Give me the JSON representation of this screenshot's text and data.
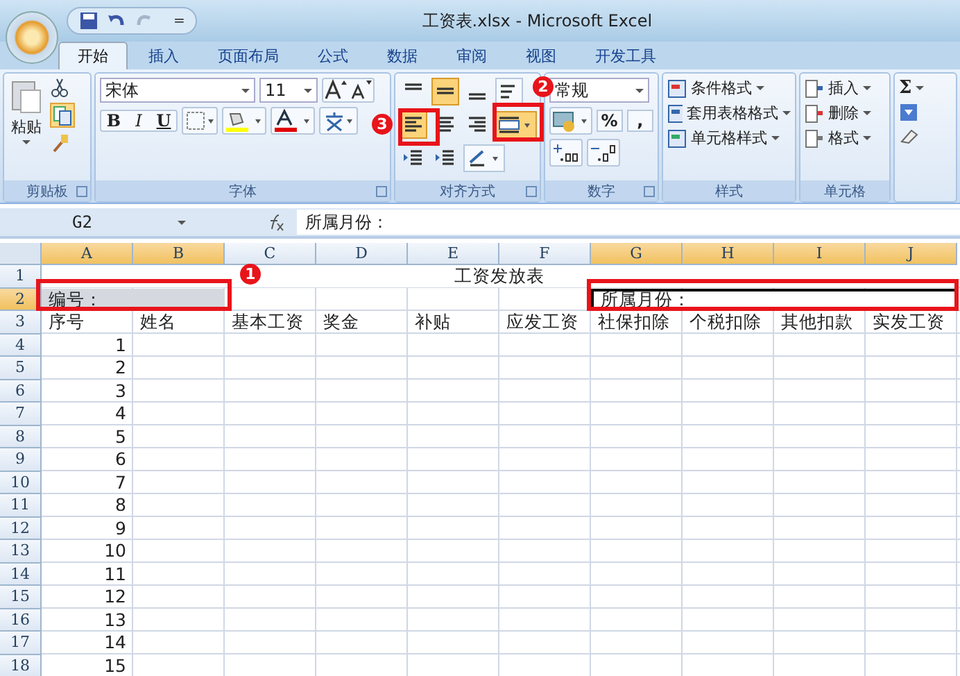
{
  "window": {
    "title": "工资表.xlsx - Microsoft Excel",
    "quick_access_more": "="
  },
  "tabs": [
    {
      "label": "开始",
      "selected": true
    },
    {
      "label": "插入",
      "selected": false
    },
    {
      "label": "页面布局",
      "selected": false
    },
    {
      "label": "公式",
      "selected": false
    },
    {
      "label": "数据",
      "selected": false
    },
    {
      "label": "审阅",
      "selected": false
    },
    {
      "label": "视图",
      "selected": false
    },
    {
      "label": "开发工具",
      "selected": false
    }
  ],
  "ribbon": {
    "clipboard": {
      "label": "剪贴板",
      "paste": "粘贴"
    },
    "font": {
      "label": "字体",
      "font_name": "宋体",
      "font_size": "11",
      "bold": "B",
      "italic": "I",
      "underline": "U"
    },
    "alignment": {
      "label": "对齐方式",
      "buttons": [
        {
          "kind": "top",
          "selected": false
        },
        {
          "kind": "middle",
          "selected": true
        },
        {
          "kind": "bottom",
          "selected": false
        },
        {
          "kind": "wrap",
          "selected": false
        },
        {
          "kind": "left",
          "selected": true
        },
        {
          "kind": "center",
          "selected": false
        },
        {
          "kind": "right",
          "selected": false
        },
        {
          "kind": "merge",
          "selected": true
        },
        {
          "kind": "outdent",
          "selected": false
        },
        {
          "kind": "indent",
          "selected": false
        },
        {
          "kind": "orientation",
          "selected": false
        }
      ]
    },
    "number": {
      "label": "数字",
      "format": "常规",
      "percent": "%",
      "comma": ","
    },
    "styles": {
      "label": "样式",
      "items": [
        "条件格式",
        "套用表格格式",
        "单元格样式"
      ]
    },
    "cells": {
      "label": "单元格",
      "items": [
        "插入",
        "删除",
        "格式"
      ]
    },
    "editing": {
      "sum": "Σ"
    }
  },
  "formula_bar": {
    "name_box": "G2",
    "content": "所属月份："
  },
  "sheet": {
    "columns": [
      {
        "label": "A",
        "selected": true
      },
      {
        "label": "B",
        "selected": true
      },
      {
        "label": "C",
        "selected": false
      },
      {
        "label": "D",
        "selected": false
      },
      {
        "label": "E",
        "selected": false
      },
      {
        "label": "F",
        "selected": false
      },
      {
        "label": "G",
        "selected": true
      },
      {
        "label": "H",
        "selected": true
      },
      {
        "label": "I",
        "selected": true
      },
      {
        "label": "J",
        "selected": true
      }
    ],
    "rows": [
      {
        "header": "1",
        "selected": false,
        "cells": [
          {
            "kind": "title",
            "text": "工资发放表"
          }
        ]
      },
      {
        "header": "2",
        "selected": true,
        "cells": [
          {
            "kind": "label",
            "text": "编号：",
            "selected": true
          },
          {
            "kind": "merged"
          },
          {
            "kind": "empty"
          },
          {
            "kind": "empty"
          },
          {
            "kind": "empty"
          },
          {
            "kind": "empty"
          },
          {
            "kind": "active",
            "text": "所属月份："
          }
        ]
      },
      {
        "header": "3",
        "selected": false,
        "cells": [
          {
            "kind": "text",
            "text": "序号"
          },
          {
            "kind": "text",
            "text": "姓名"
          },
          {
            "kind": "text",
            "text": "基本工资"
          },
          {
            "kind": "text",
            "text": "奖金"
          },
          {
            "kind": "text",
            "text": "补贴"
          },
          {
            "kind": "text",
            "text": "应发工资"
          },
          {
            "kind": "text",
            "text": "社保扣除"
          },
          {
            "kind": "text",
            "text": "个税扣除"
          },
          {
            "kind": "text",
            "text": "其他扣款"
          },
          {
            "kind": "text",
            "text": "实发工资"
          }
        ]
      },
      {
        "header": "4",
        "selected": false,
        "cells": [
          {
            "kind": "number",
            "text": "1"
          }
        ]
      },
      {
        "header": "5",
        "selected": false,
        "cells": [
          {
            "kind": "number",
            "text": "2"
          }
        ]
      },
      {
        "header": "6",
        "selected": false,
        "cells": [
          {
            "kind": "number",
            "text": "3"
          }
        ]
      },
      {
        "header": "7",
        "selected": false,
        "cells": [
          {
            "kind": "number",
            "text": "4"
          }
        ]
      },
      {
        "header": "8",
        "selected": false,
        "cells": [
          {
            "kind": "number",
            "text": "5"
          }
        ]
      },
      {
        "header": "9",
        "selected": false,
        "cells": [
          {
            "kind": "number",
            "text": "6"
          }
        ]
      },
      {
        "header": "10",
        "selected": false,
        "cells": [
          {
            "kind": "number",
            "text": "7"
          }
        ]
      },
      {
        "header": "11",
        "selected": false,
        "cells": [
          {
            "kind": "number",
            "text": "8"
          }
        ]
      },
      {
        "header": "12",
        "selected": false,
        "cells": [
          {
            "kind": "number",
            "text": "9"
          }
        ]
      },
      {
        "header": "13",
        "selected": false,
        "cells": [
          {
            "kind": "number",
            "text": "10"
          }
        ]
      },
      {
        "header": "14",
        "selected": false,
        "cells": [
          {
            "kind": "number",
            "text": "11"
          }
        ]
      },
      {
        "header": "15",
        "selected": false,
        "cells": [
          {
            "kind": "number",
            "text": "12"
          }
        ]
      },
      {
        "header": "16",
        "selected": false,
        "cells": [
          {
            "kind": "number",
            "text": "13"
          }
        ]
      },
      {
        "header": "17",
        "selected": false,
        "cells": [
          {
            "kind": "number",
            "text": "14"
          }
        ]
      },
      {
        "header": "18",
        "selected": false,
        "cells": [
          {
            "kind": "number",
            "text": "15"
          }
        ]
      }
    ]
  },
  "step_badges": [
    {
      "text": "1"
    },
    {
      "text": "2"
    },
    {
      "text": "3"
    }
  ]
}
